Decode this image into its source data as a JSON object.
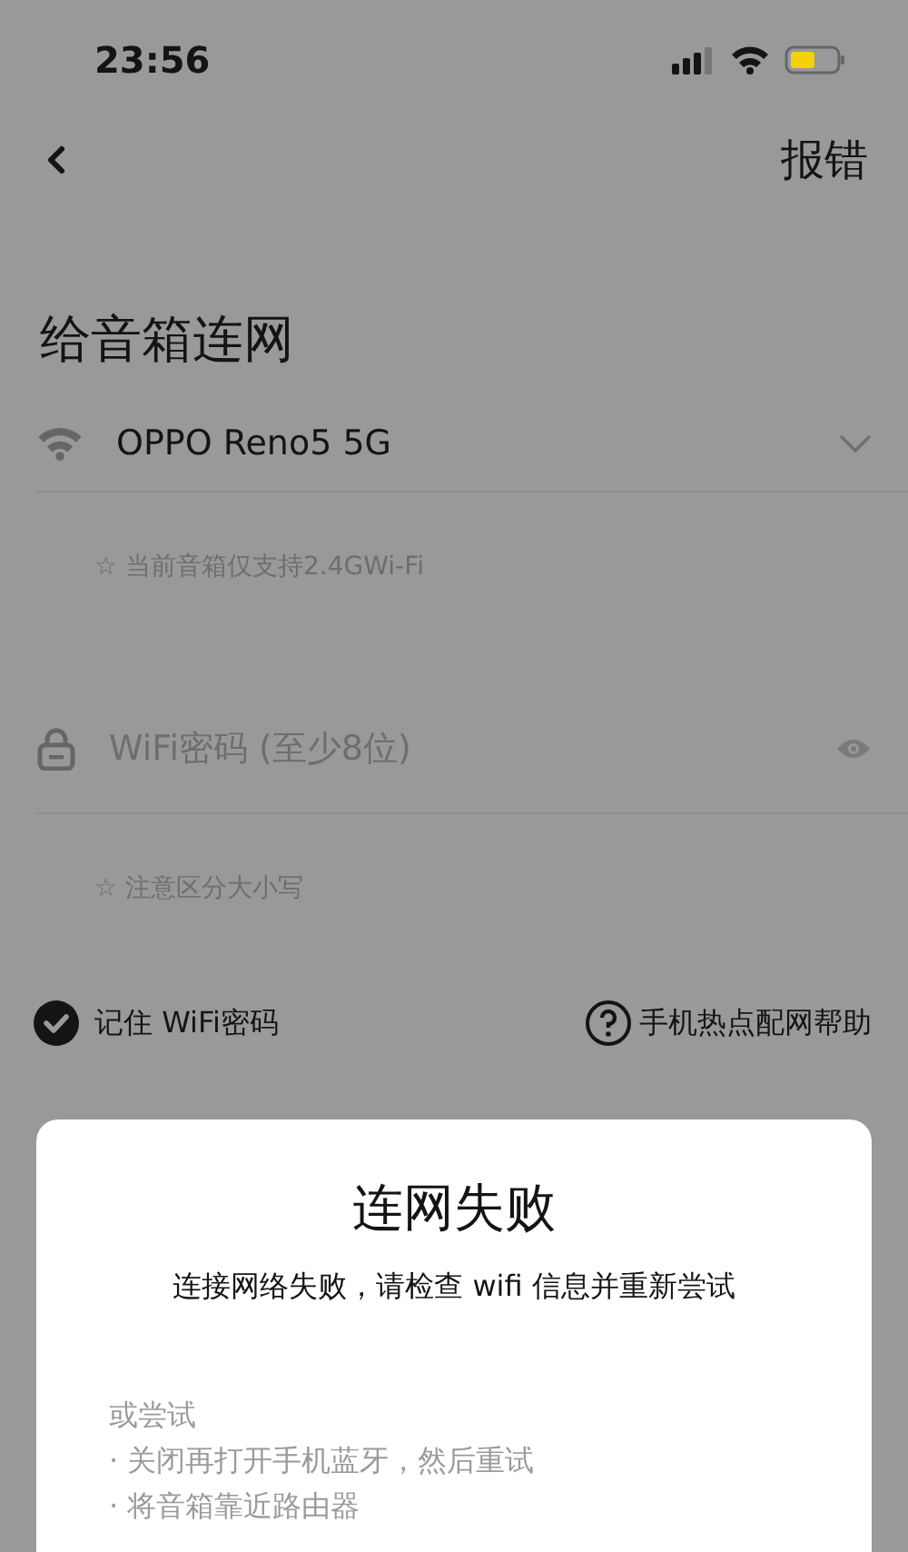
{
  "status_bar": {
    "time": "23:56"
  },
  "nav": {
    "report_button": "报错"
  },
  "title": "给音箱连网",
  "network": {
    "name": "OPPO Reno5 5G"
  },
  "network_hint": "☆ 当前音箱仅支持2.4GWi-Fi",
  "password": {
    "placeholder": "WiFi密码 (至少8位)"
  },
  "password_hint": "☆ 注意区分大小写",
  "remember": {
    "label": "记住 WiFi密码",
    "checked": true
  },
  "help_link": "手机热点配网帮助",
  "dialog": {
    "title": "连网失败",
    "message": "连接网络失败，请检查 wifi 信息并重新尝试",
    "alternatives_heading": "或尝试",
    "alternatives": [
      "· 关闭再打开手机蓝牙，然后重试",
      "· 将音箱靠近路由器"
    ]
  }
}
